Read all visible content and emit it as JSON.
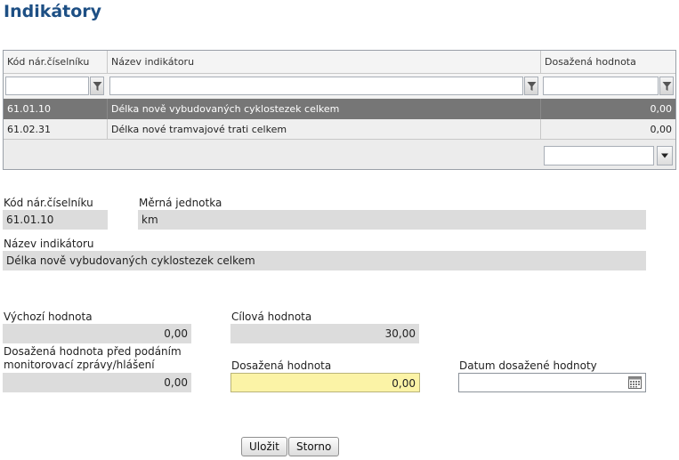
{
  "page": {
    "title": "Indikátory"
  },
  "grid": {
    "columns": [
      "Kód nár.číselníku",
      "Název indikátoru",
      "Dosažená hodnota"
    ],
    "rows": [
      {
        "code": "61.01.10",
        "name": "Délka nově vybudovaných cyklostezek celkem",
        "value": "0,00",
        "selected": true
      },
      {
        "code": "61.02.31",
        "name": "Délka nové tramvajové trati celkem",
        "value": "0,00",
        "selected": false
      }
    ]
  },
  "detail": {
    "code_label": "Kód nár.číselníku",
    "code_value": "61.01.10",
    "unit_label": "Měrná jednotka",
    "unit_value": "km",
    "name_label": "Název indikátoru",
    "name_value": "Délka nově vybudovaných cyklostezek celkem",
    "initial_label": "Výchozí hodnota",
    "initial_value": "0,00",
    "target_label": "Cílová hodnota",
    "target_value": "30,00",
    "before_label_line1": "Dosažená hodnota před podáním",
    "before_label_line2": "monitorovací zprávy/hlášení",
    "before_value": "0,00",
    "achieved_label": "Dosažená hodnota",
    "achieved_value": "0,00",
    "date_label": "Datum dosažené hodnoty",
    "date_value": ""
  },
  "buttons": {
    "save": "Uložit",
    "cancel": "Storno"
  },
  "icons": {
    "filter": "filter-icon",
    "dropdown": "chevron-down-icon",
    "calendar": "calendar-icon"
  }
}
